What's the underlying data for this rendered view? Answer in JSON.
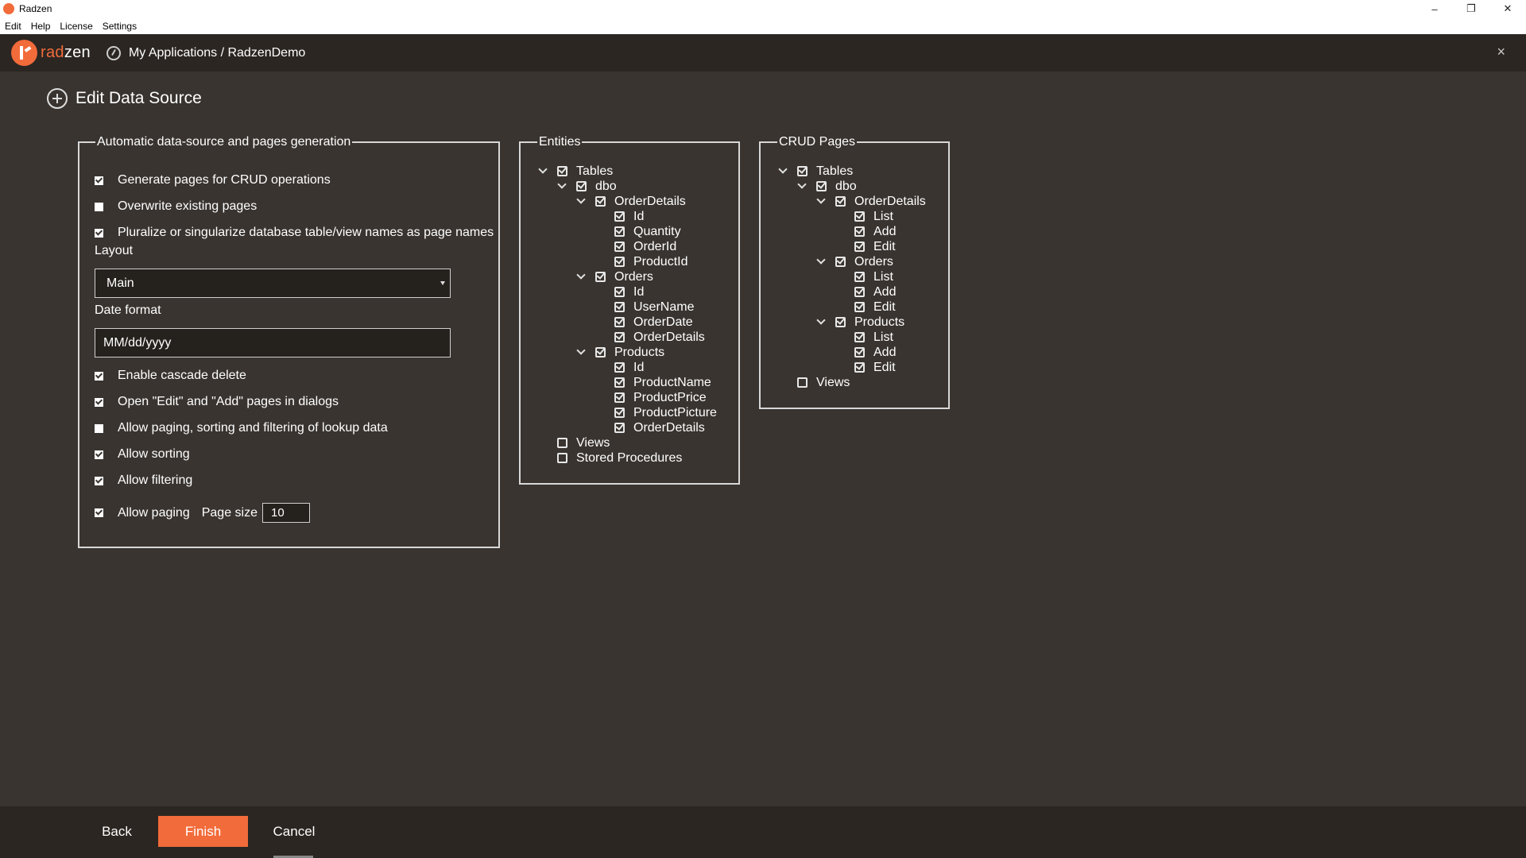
{
  "window": {
    "title": "Radzen",
    "controls": {
      "minimize": "–",
      "restore": "❐",
      "close": "✕"
    }
  },
  "menu": [
    "Edit",
    "Help",
    "License",
    "Settings"
  ],
  "header": {
    "logo_prefix": "rad",
    "logo_suffix": "zen",
    "breadcrumb": "My Applications / RadzenDemo",
    "close": "×"
  },
  "page": {
    "title": "Edit Data Source"
  },
  "generation": {
    "legend": "Automatic data-source and pages generation",
    "options": [
      {
        "label": "Generate pages for CRUD operations",
        "checked": true
      },
      {
        "label": "Overwrite existing pages",
        "checked": false
      },
      {
        "label": "Pluralize or singularize database table/view names as page names",
        "checked": true
      }
    ],
    "layout_label": "Layout",
    "layout_value": "Main",
    "date_format_label": "Date format",
    "date_format_value": "MM/dd/yyyy",
    "options2": [
      {
        "label": "Enable cascade delete",
        "checked": true
      },
      {
        "label": "Open \"Edit\" and \"Add\" pages in dialogs",
        "checked": true
      },
      {
        "label": "Allow paging, sorting and filtering of lookup data",
        "checked": false
      },
      {
        "label": "Allow sorting",
        "checked": true
      },
      {
        "label": "Allow filtering",
        "checked": true
      }
    ],
    "allow_paging": {
      "label": "Allow paging",
      "checked": true
    },
    "page_size_label": "Page size",
    "page_size_value": "10"
  },
  "entities": {
    "legend": "Entities",
    "nodes": [
      {
        "label": "Tables",
        "level": 0,
        "expanded": true,
        "checked": true
      },
      {
        "label": "dbo",
        "level": 1,
        "expanded": true,
        "checked": true
      },
      {
        "label": "OrderDetails",
        "level": 2,
        "expanded": true,
        "checked": true
      },
      {
        "label": "Id",
        "level": 3,
        "checked": true
      },
      {
        "label": "Quantity",
        "level": 3,
        "checked": true
      },
      {
        "label": "OrderId",
        "level": 3,
        "checked": true
      },
      {
        "label": "ProductId",
        "level": 3,
        "checked": true
      },
      {
        "label": "Orders",
        "level": 2,
        "expanded": true,
        "checked": true
      },
      {
        "label": "Id",
        "level": 3,
        "checked": true
      },
      {
        "label": "UserName",
        "level": 3,
        "checked": true
      },
      {
        "label": "OrderDate",
        "level": 3,
        "checked": true
      },
      {
        "label": "OrderDetails",
        "level": 3,
        "checked": true
      },
      {
        "label": "Products",
        "level": 2,
        "expanded": true,
        "checked": true
      },
      {
        "label": "Id",
        "level": 3,
        "checked": true
      },
      {
        "label": "ProductName",
        "level": 3,
        "checked": true
      },
      {
        "label": "ProductPrice",
        "level": 3,
        "checked": true
      },
      {
        "label": "ProductPicture",
        "level": 3,
        "checked": true
      },
      {
        "label": "OrderDetails",
        "level": 3,
        "checked": true
      },
      {
        "label": "Views",
        "level": 0,
        "checked": false
      },
      {
        "label": "Stored Procedures",
        "level": 0,
        "checked": false
      }
    ]
  },
  "crud": {
    "legend": "CRUD Pages",
    "nodes": [
      {
        "label": "Tables",
        "level": 0,
        "expanded": true,
        "checked": true
      },
      {
        "label": "dbo",
        "level": 1,
        "expanded": true,
        "checked": true
      },
      {
        "label": "OrderDetails",
        "level": 2,
        "expanded": true,
        "checked": true
      },
      {
        "label": "List",
        "level": 3,
        "checked": true
      },
      {
        "label": "Add",
        "level": 3,
        "checked": true
      },
      {
        "label": "Edit",
        "level": 3,
        "checked": true
      },
      {
        "label": "Orders",
        "level": 2,
        "expanded": true,
        "checked": true
      },
      {
        "label": "List",
        "level": 3,
        "checked": true
      },
      {
        "label": "Add",
        "level": 3,
        "checked": true
      },
      {
        "label": "Edit",
        "level": 3,
        "checked": true
      },
      {
        "label": "Products",
        "level": 2,
        "expanded": true,
        "checked": true
      },
      {
        "label": "List",
        "level": 3,
        "checked": true
      },
      {
        "label": "Add",
        "level": 3,
        "checked": true
      },
      {
        "label": "Edit",
        "level": 3,
        "checked": true
      },
      {
        "label": "Views",
        "level": 0,
        "checked": false
      }
    ]
  },
  "footer": {
    "back": "Back",
    "finish": "Finish",
    "cancel": "Cancel"
  },
  "colors": {
    "accent": "#f26b3a",
    "background": "#393430",
    "header": "#2b2622"
  }
}
